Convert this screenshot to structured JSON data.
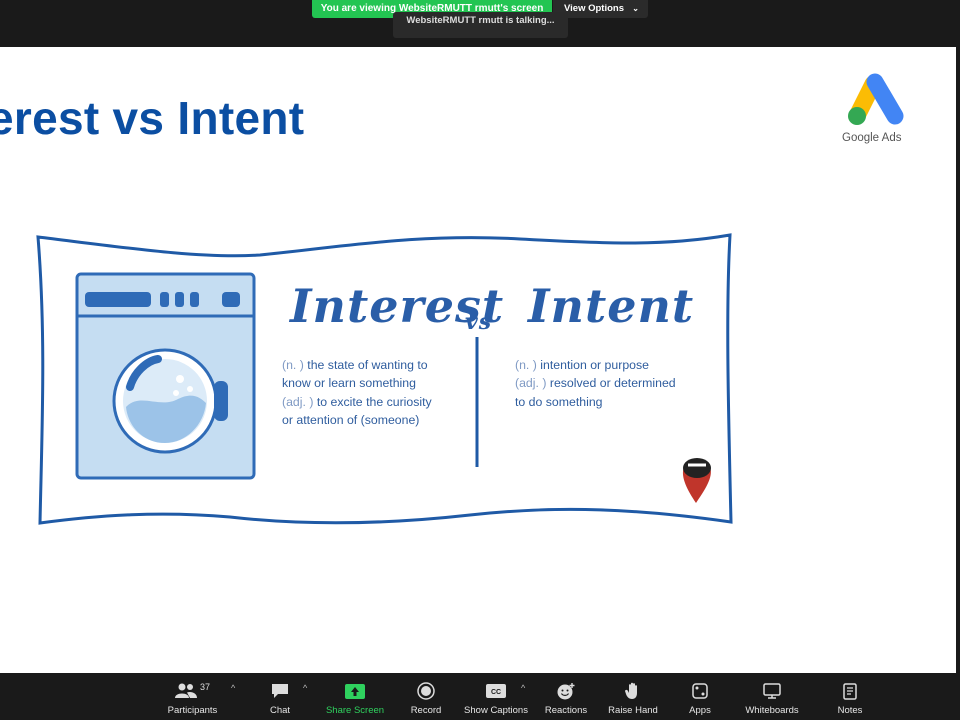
{
  "meeting": {
    "share_banner": "You are viewing WebsiteRMUTT rmutt's screen",
    "view_options": "View Options",
    "talking": "WebsiteRMUTT rmutt is talking..."
  },
  "slide": {
    "title": "erest vs Intent",
    "logo_label": "Google Ads",
    "word_left": "Interest",
    "word_vs": "vs",
    "word_right": "Intent",
    "left_definition": [
      {
        "pos": "(n. )",
        "text": " the state of wanting to"
      },
      {
        "pos": "",
        "text": "know or learn something"
      },
      {
        "pos": "(adj. )",
        "text": " to excite the curiosity"
      },
      {
        "pos": "",
        "text": "or attention of (someone)"
      }
    ],
    "right_definition": [
      {
        "pos": "(n. )",
        "text": " intention or purpose"
      },
      {
        "pos": "(adj. )",
        "text": " resolved or determined"
      },
      {
        "pos": "",
        "text": "to do something"
      }
    ],
    "colors": {
      "title": "#0b4ea2",
      "banner_stroke": "#1f5aa6",
      "washer_fill": "#c5ddf2"
    }
  },
  "toolbar": {
    "participants": "Participants",
    "participant_count": "37",
    "chat": "Chat",
    "share_screen": "Share Screen",
    "record": "Record",
    "show_captions": "Show Captions",
    "reactions": "Reactions",
    "raise_hand": "Raise Hand",
    "apps": "Apps",
    "whiteboards": "Whiteboards",
    "notes": "Notes",
    "accent": "#2fd15e"
  }
}
